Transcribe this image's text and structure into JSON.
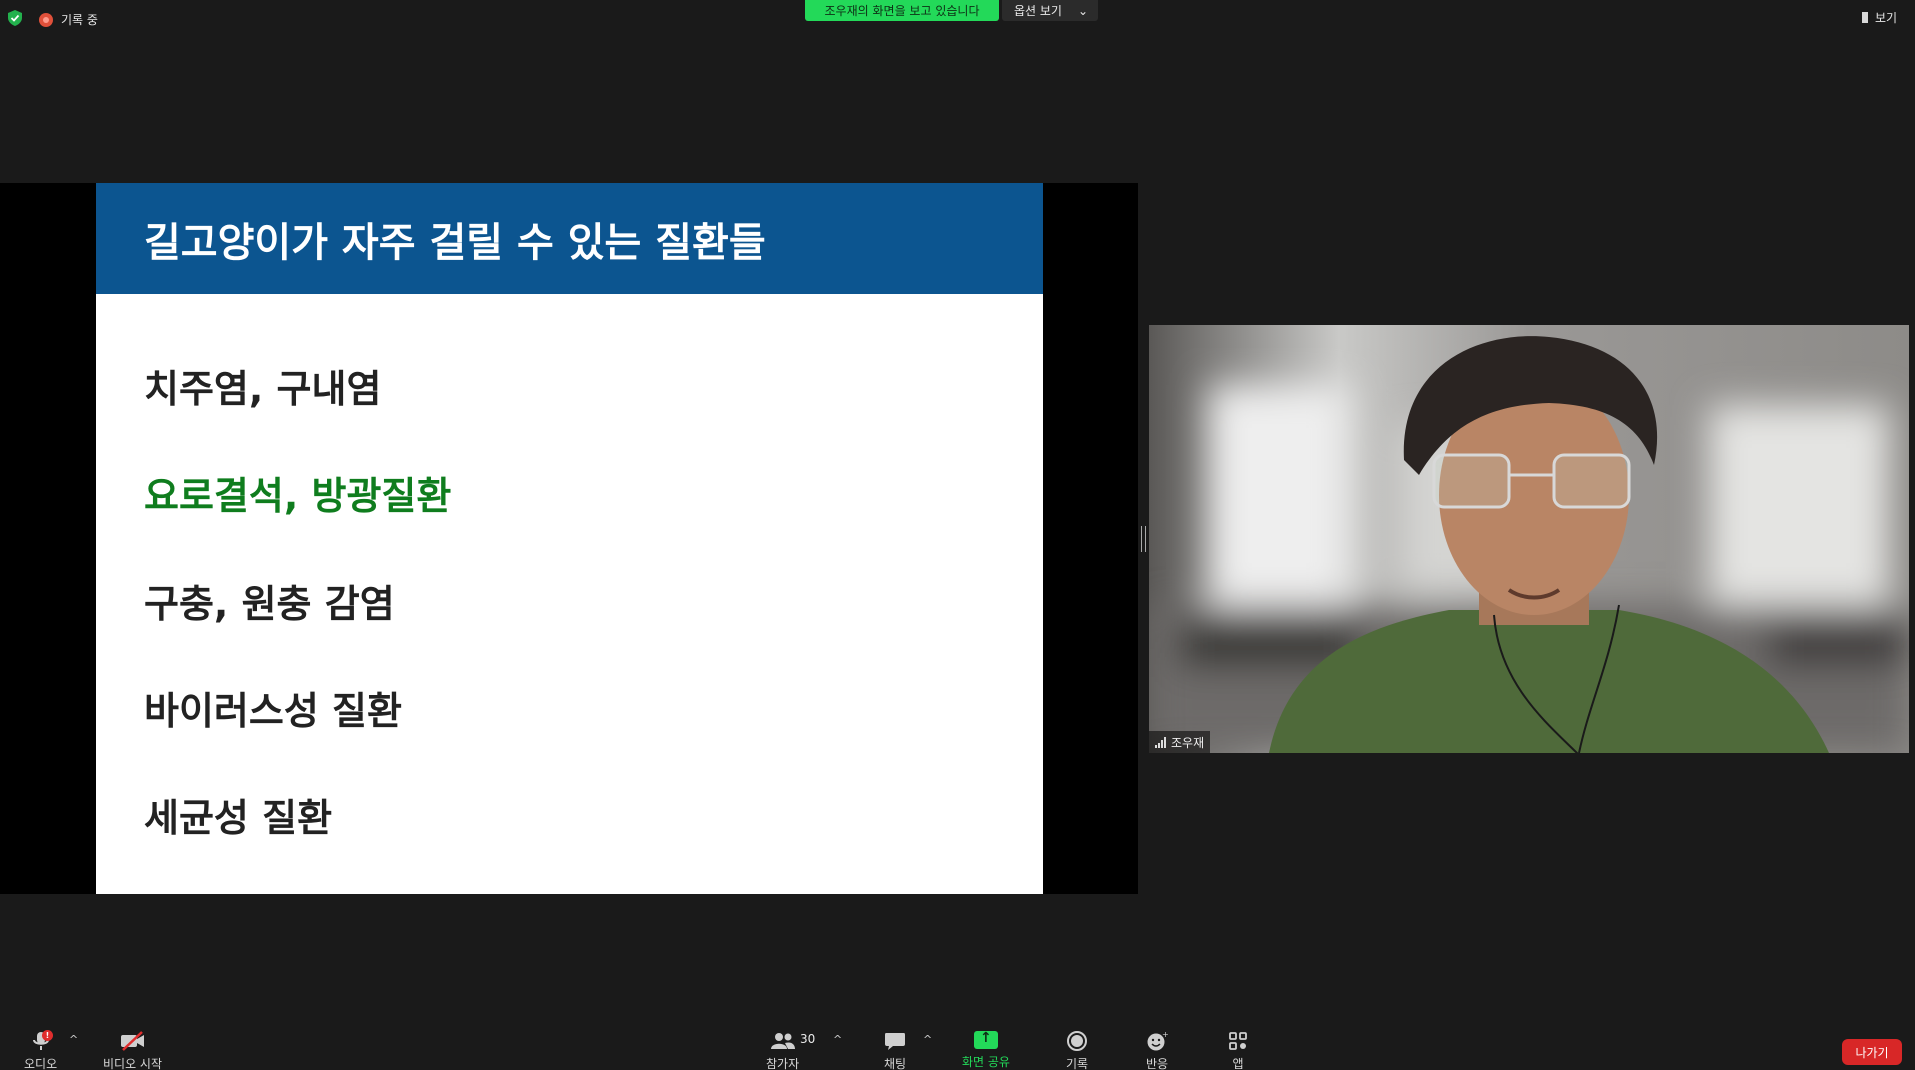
{
  "topbar": {
    "recording_label": "기록 중",
    "share_banner": "조우재의 화면을 보고 있습니다",
    "options_label": "옵션 보기",
    "view_label": "보기"
  },
  "slide": {
    "title": "길고양이가 자주 걸릴 수 있는 질환들",
    "items": [
      "치주염, 구내염",
      "요로결석, 방광질환",
      "구충, 원충 감염",
      "바이러스성 질환",
      "세균성 질환"
    ],
    "colors": {
      "header": "#0c5590",
      "highlight": "#0f7d1e"
    }
  },
  "video": {
    "participant_name": "조우재"
  },
  "toolbar": {
    "audio": "오디오",
    "video_start": "비디오 시작",
    "participants": "참가자",
    "participants_count": "30",
    "chat": "채팅",
    "share": "화면 공유",
    "record": "기록",
    "reactions": "반응",
    "apps": "앱",
    "leave": "나가기"
  },
  "icons": {
    "security": "shield-check-icon",
    "recording": "record-dot-icon",
    "mic": "microphone-icon",
    "video_off": "video-off-icon",
    "participants": "people-icon",
    "chat": "chat-bubble-icon",
    "share": "share-screen-icon",
    "record": "record-icon",
    "reactions": "emoji-plus-icon",
    "apps": "apps-icon"
  },
  "accent_color": "#23d959"
}
